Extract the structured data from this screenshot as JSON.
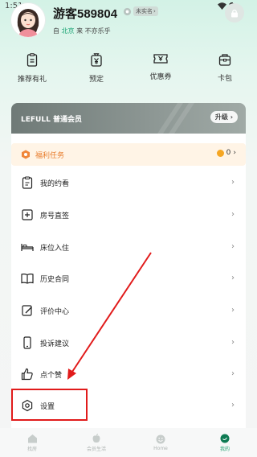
{
  "status": {
    "time": "1:51"
  },
  "profile": {
    "username": "游客589804",
    "verify_label": "未实名",
    "location_prefix": "自",
    "city": "北京",
    "location_suffix": "来 不亦乐乎"
  },
  "quick_actions": [
    {
      "label": "推荐有礼",
      "icon": "gift-icon"
    },
    {
      "label": "预定",
      "icon": "yen-bag-icon"
    },
    {
      "label": "优惠券",
      "icon": "coupon-icon"
    },
    {
      "label": "卡包",
      "icon": "card-bag-icon"
    }
  ],
  "member": {
    "title": "LEFULL 普通会员",
    "upgrade_label": "升级"
  },
  "welfare": {
    "label": "福利任务",
    "count": "0"
  },
  "menu": [
    {
      "label": "我的约看",
      "icon": "appointment-clipboard-icon"
    },
    {
      "label": "房号直签",
      "icon": "sign-plus-icon"
    },
    {
      "label": "床位入住",
      "icon": "bed-icon"
    },
    {
      "label": "历史合同",
      "icon": "contract-book-icon"
    },
    {
      "label": "评价中心",
      "icon": "review-edit-icon"
    },
    {
      "label": "投诉建议",
      "icon": "complaint-phone-icon"
    },
    {
      "label": "点个赞",
      "icon": "thumbs-up-icon"
    },
    {
      "label": "设置",
      "icon": "settings-gear-icon"
    }
  ],
  "bottom_nav": [
    {
      "label": "找房",
      "active": false
    },
    {
      "label": "会员生活",
      "active": false
    },
    {
      "label": "Home",
      "active": false
    },
    {
      "label": "我的",
      "active": true
    }
  ],
  "colors": {
    "accent_green": "#1e9e6e",
    "welfare_orange": "#e87c2c",
    "highlight_red": "#e11b1b"
  }
}
